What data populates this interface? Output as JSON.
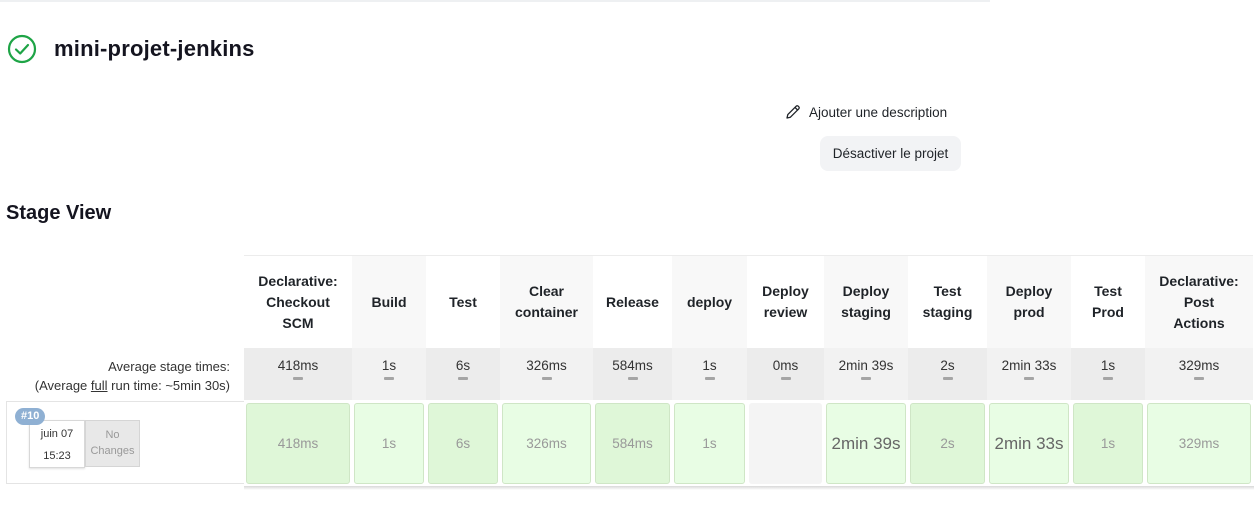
{
  "job": {
    "title": "mini-projet-jenkins",
    "status_icon": "success-check-circle-icon",
    "status_color": "#1ea446"
  },
  "actions": {
    "add_description_label": "Ajouter une description",
    "disable_label": "Désactiver le projet"
  },
  "stage_view": {
    "title": "Stage View",
    "average_label_line1": "Average stage times:",
    "average_label_prefix": "(Average ",
    "average_label_full": "full",
    "average_label_suffix": " run time: ~5min 30s)",
    "build": {
      "number": "#10",
      "date": "juin 07",
      "time": "15:23",
      "changes": "No Changes"
    },
    "stages": [
      {
        "name_lines": [
          "Declarative:",
          "Checkout",
          "SCM"
        ],
        "avg": "418ms",
        "run": "418ms",
        "shade": "#dff7d8",
        "head_bg": "#ffffff",
        "avg_bg": "#ececec",
        "big": false
      },
      {
        "name_lines": [
          "Build"
        ],
        "avg": "1s",
        "run": "1s",
        "shade": "#e8fde4",
        "head_bg": "#f8f8f8",
        "avg_bg": "#f2f2f2",
        "big": false
      },
      {
        "name_lines": [
          "Test"
        ],
        "avg": "6s",
        "run": "6s",
        "shade": "#dff7d8",
        "head_bg": "#ffffff",
        "avg_bg": "#ececec",
        "big": false
      },
      {
        "name_lines": [
          "Clear",
          "container"
        ],
        "avg": "326ms",
        "run": "326ms",
        "shade": "#e8fde4",
        "head_bg": "#f8f8f8",
        "avg_bg": "#f2f2f2",
        "big": false
      },
      {
        "name_lines": [
          "Release"
        ],
        "avg": "584ms",
        "run": "584ms",
        "shade": "#dff7d8",
        "head_bg": "#ffffff",
        "avg_bg": "#ececec",
        "big": false
      },
      {
        "name_lines": [
          "deploy"
        ],
        "avg": "1s",
        "run": "1s",
        "shade": "#e8fde4",
        "head_bg": "#f8f8f8",
        "avg_bg": "#f2f2f2",
        "big": false
      },
      {
        "name_lines": [
          "Deploy",
          "review"
        ],
        "avg": "0ms",
        "run": "",
        "shade": "#f4f4f4",
        "head_bg": "#ffffff",
        "avg_bg": "#ececec",
        "big": false
      },
      {
        "name_lines": [
          "Deploy",
          "staging"
        ],
        "avg": "2min 39s",
        "run": "2min 39s",
        "shade": "#e8fde4",
        "head_bg": "#f8f8f8",
        "avg_bg": "#f2f2f2",
        "big": true
      },
      {
        "name_lines": [
          "Test",
          "staging"
        ],
        "avg": "2s",
        "run": "2s",
        "shade": "#dff7d8",
        "head_bg": "#ffffff",
        "avg_bg": "#ececec",
        "big": false
      },
      {
        "name_lines": [
          "Deploy",
          "prod"
        ],
        "avg": "2min 33s",
        "run": "2min 33s",
        "shade": "#e8fde4",
        "head_bg": "#f8f8f8",
        "avg_bg": "#f2f2f2",
        "big": true
      },
      {
        "name_lines": [
          "Test",
          "Prod"
        ],
        "avg": "1s",
        "run": "1s",
        "shade": "#dff7d8",
        "head_bg": "#ffffff",
        "avg_bg": "#ececec",
        "big": false
      },
      {
        "name_lines": [
          "Declarative:",
          "Post",
          "Actions"
        ],
        "avg": "329ms",
        "run": "329ms",
        "shade": "#e8fde4",
        "head_bg": "#f8f8f8",
        "avg_bg": "#f2f2f2",
        "big": false
      }
    ]
  }
}
